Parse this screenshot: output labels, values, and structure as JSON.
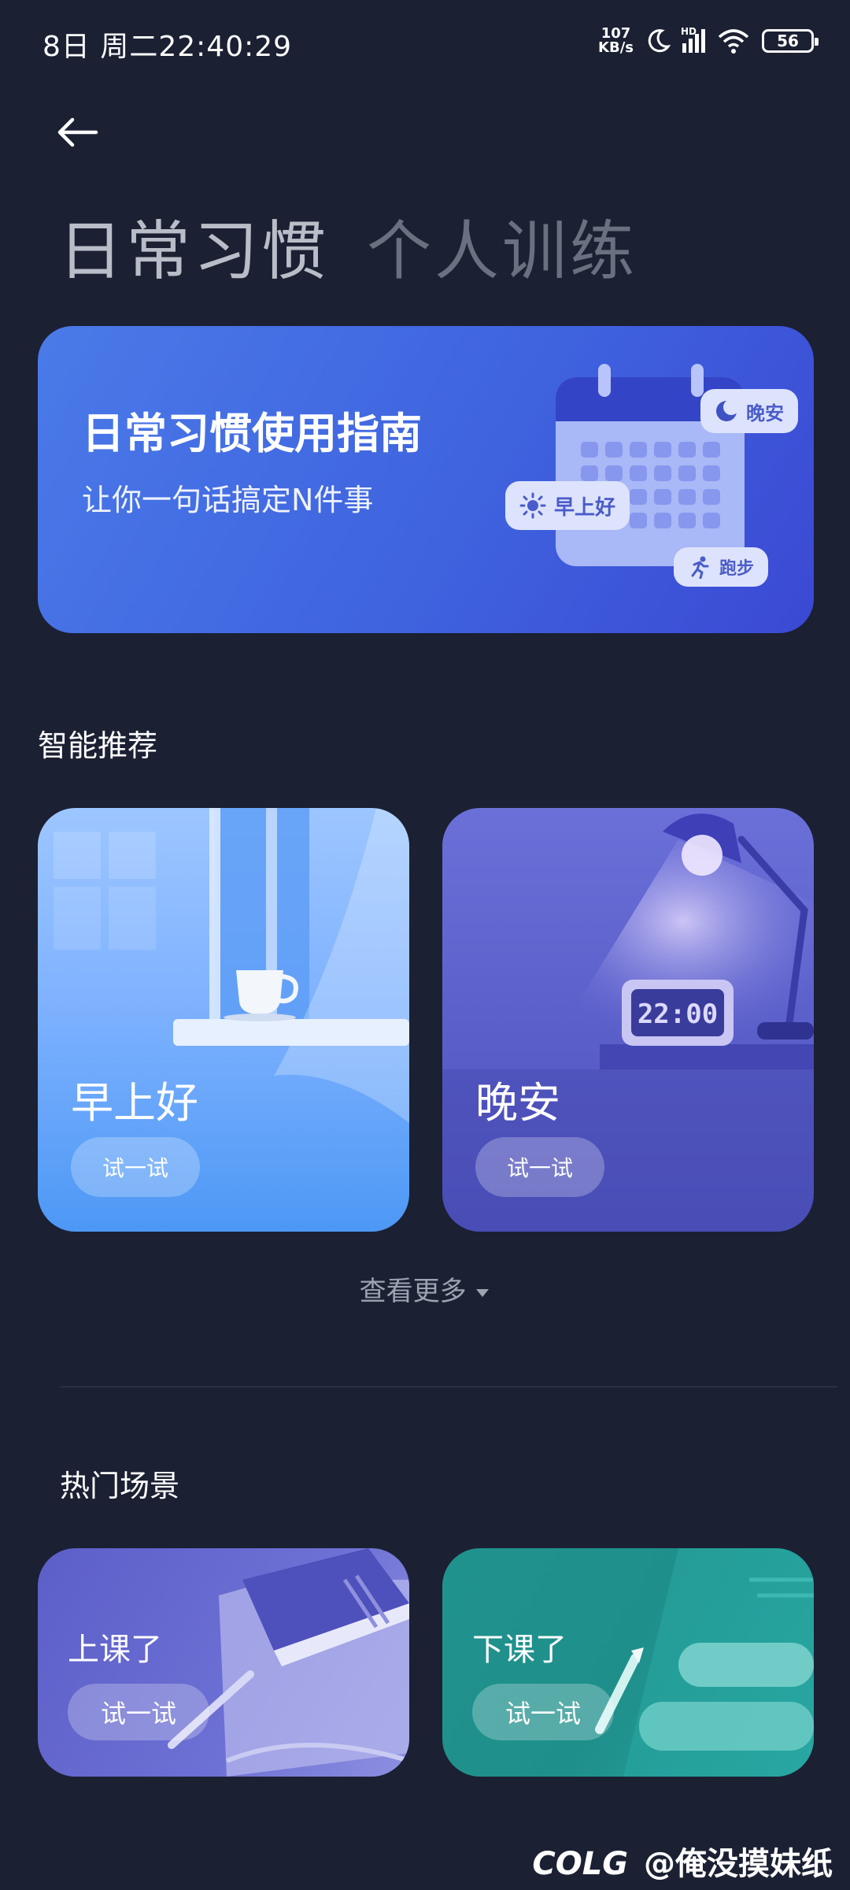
{
  "status_bar": {
    "time": "8日 周二22:40:29",
    "net_speed_value": "107",
    "net_speed_unit": "KB/s",
    "signal_label": "HD",
    "battery": "56",
    "icons": [
      "moon-icon",
      "signal-icon",
      "wifi-icon",
      "battery-icon"
    ]
  },
  "tabs": [
    {
      "label": "日常习惯",
      "active": true
    },
    {
      "label": "个人训练",
      "active": false
    }
  ],
  "guide_banner": {
    "title": "日常习惯使用指南",
    "subtitle": "让你一句话搞定N件事",
    "chips": {
      "night": "晚安",
      "morning": "早上好",
      "run": "跑步"
    }
  },
  "smart_recommend": {
    "title": "智能推荐",
    "cards": [
      {
        "label": "早上好",
        "button": "试一试",
        "color": "#7fb2ff"
      },
      {
        "label": "晚安",
        "button": "试一试",
        "color": "#5a5ec8",
        "clock_text": "22:00"
      }
    ],
    "view_more": "查看更多"
  },
  "hot_scenes": {
    "title": "热门场景",
    "cards": [
      {
        "label": "上课了",
        "button": "试一试",
        "color": "#6366cc"
      },
      {
        "label": "下课了",
        "button": "试一试",
        "color": "#1f8f8b"
      }
    ]
  },
  "watermark": {
    "logo": "COLG",
    "text": "@俺没摸妹纸"
  }
}
